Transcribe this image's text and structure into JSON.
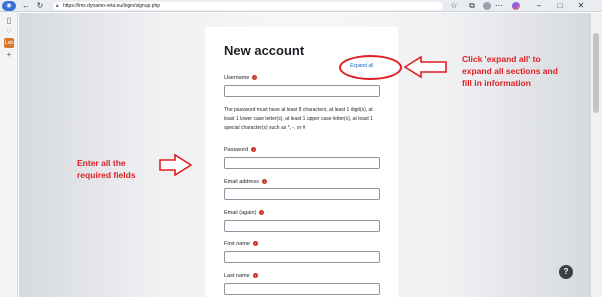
{
  "browser": {
    "url": "https://lms.dynamo-reta.eu/login/signup.php",
    "profile_icon": "profile-icon",
    "icons": [
      "back-arrow-icon",
      "refresh-icon",
      "home-icon",
      "lock-icon",
      "favorite-star-icon",
      "extensions-icon",
      "avatar-icon",
      "copilot-icon",
      "minimize-icon",
      "maximize-icon",
      "close-icon"
    ]
  },
  "sidebar": {
    "app_label": "Lab"
  },
  "form": {
    "title": "New account",
    "expand_all": "Expand all",
    "password_note": "The password must have at least 8 characters, at least 1 digit(s), at least 1 lower case letter(s), at least 1 upper case letter(s), at least 1 special character(s) such as *, -, or #",
    "fields": {
      "username": "Username",
      "password": "Password",
      "email": "Email address",
      "email_again": "Email (again)",
      "first_name": "First name",
      "last_name": "Last name"
    },
    "required_mark": "!"
  },
  "annotations": {
    "expand_note": [
      "Click 'expand all' to",
      "expand all sections and",
      "fill in information"
    ],
    "fields_note": [
      "Enter all the",
      "required fields"
    ],
    "color": "#e01e24"
  },
  "help_button": "?"
}
